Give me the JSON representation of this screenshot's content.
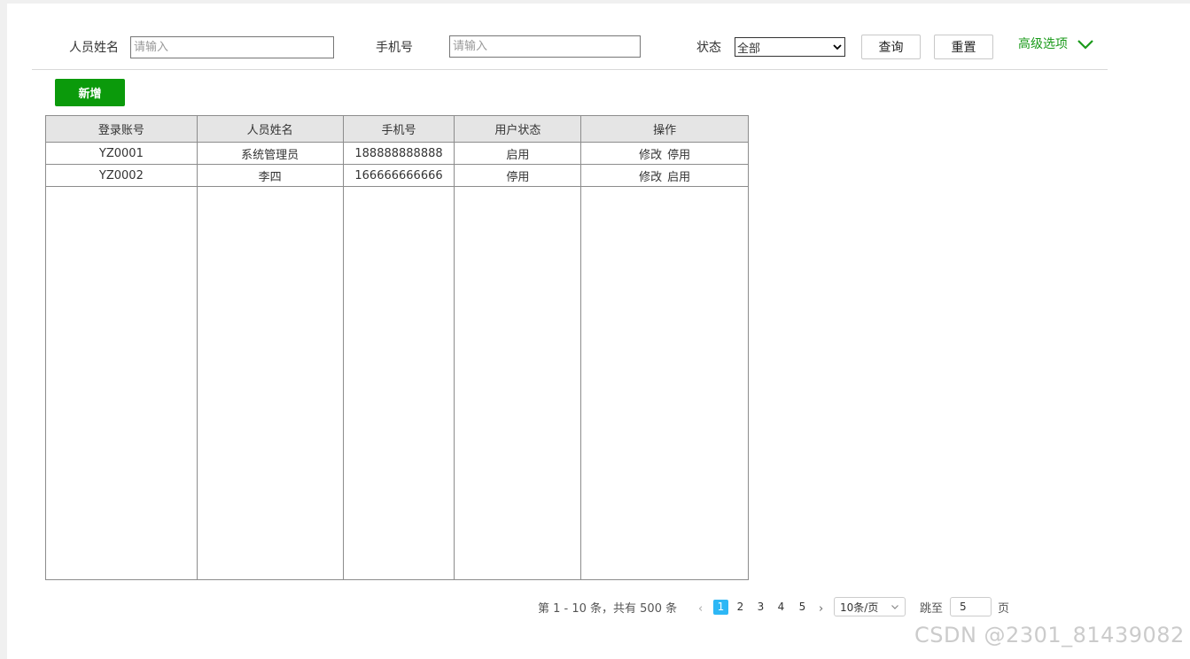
{
  "filters": {
    "name_label": "人员姓名",
    "name_placeholder": "请输入",
    "phone_label": "手机号",
    "phone_placeholder": "请输入",
    "status_label": "状态",
    "status_selected": "全部",
    "query_label": "查询",
    "reset_label": "重置",
    "advanced_label": "高级选项"
  },
  "toolbar": {
    "add_label": "新增"
  },
  "table": {
    "headers": [
      "登录账号",
      "人员姓名",
      "手机号",
      "用户状态",
      "操作"
    ],
    "rows": [
      {
        "account": "YZ0001",
        "name": "系统管理员",
        "phone": "188888888888",
        "status": "启用",
        "ops": [
          "修改",
          "停用"
        ]
      },
      {
        "account": "YZ0002",
        "name": "李四",
        "phone": "166666666666",
        "status": "停用",
        "ops": [
          "修改",
          "启用"
        ]
      }
    ]
  },
  "pagination": {
    "summary": "第 1 - 10 条，共有 500 条",
    "prev": "‹",
    "next": "›",
    "pages": [
      "1",
      "2",
      "3",
      "4",
      "5"
    ],
    "active_page": "1",
    "page_size": "10条/页",
    "jump_label": "跳至",
    "jump_value": "5",
    "jump_unit": "页"
  },
  "watermark": "CSDN @2301_81439082",
  "colors": {
    "accent_green": "#0b9a0b",
    "pager_active": "#2db7f5"
  }
}
